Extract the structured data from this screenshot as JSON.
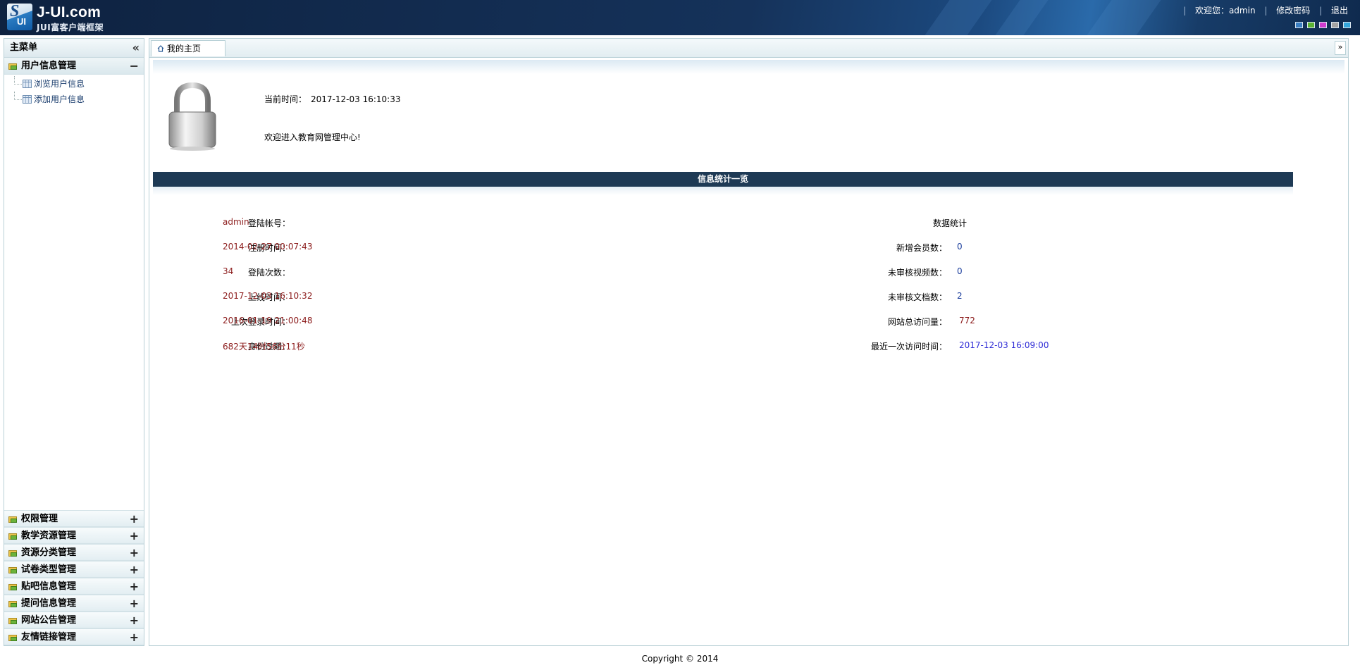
{
  "header": {
    "logo_title": "J-UI.com",
    "logo_subtitle": "JUI富客户端框架",
    "welcome": "欢迎您：admin",
    "change_password": "修改密码",
    "logout": "退出",
    "theme_colors": [
      "#3a7fc2",
      "#5ab233",
      "#d03ccf",
      "#a3a3a3",
      "#33a6dc"
    ]
  },
  "sidebar": {
    "title": "主菜单",
    "open_group": {
      "label": "用户信息管理",
      "toggle": "−",
      "items": [
        "浏览用户信息",
        "添加用户信息"
      ]
    },
    "groups": [
      {
        "label": "权限管理",
        "toggle": "+"
      },
      {
        "label": "教学资源管理",
        "toggle": "+"
      },
      {
        "label": "资源分类管理",
        "toggle": "+"
      },
      {
        "label": "试卷类型管理",
        "toggle": "+"
      },
      {
        "label": "贴吧信息管理",
        "toggle": "+"
      },
      {
        "label": "提问信息管理",
        "toggle": "+"
      },
      {
        "label": "网站公告管理",
        "toggle": "+"
      },
      {
        "label": "友情链接管理",
        "toggle": "+"
      }
    ]
  },
  "main": {
    "tab_label": "我的主页",
    "time_label": "当前时间：",
    "time_value": "2017-12-03 16:10:33",
    "welcome_message": "欢迎进入教育网管理中心!",
    "stats_title": "信息统计一览",
    "left_stats": [
      {
        "label": "登陆帐号：",
        "value": "admin"
      },
      {
        "label": "注册时间：",
        "value": "2014-02-27 00:07:43"
      },
      {
        "label": "登陆次数：",
        "value": "34"
      },
      {
        "label": "上线时间：",
        "value": "2017-12-03 16:10:32"
      },
      {
        "label": "上次登录时间：",
        "value": "2016-01-19 21:00:48"
      },
      {
        "label": "身份过期：",
        "value": "682天14时56分11秒"
      }
    ],
    "right_title": "数据统计",
    "right_stats": [
      {
        "label": "新增会员数：",
        "value": "0"
      },
      {
        "label": "未审核视频数：",
        "value": "0"
      },
      {
        "label": "未审核文档数：",
        "value": "2"
      },
      {
        "label": "网站总访问量：",
        "value": "772"
      },
      {
        "label": "最近一次访问时间：",
        "value": "2017-12-03 16:09:00"
      }
    ]
  },
  "footer": {
    "copyright": "Copyright © 2014"
  }
}
